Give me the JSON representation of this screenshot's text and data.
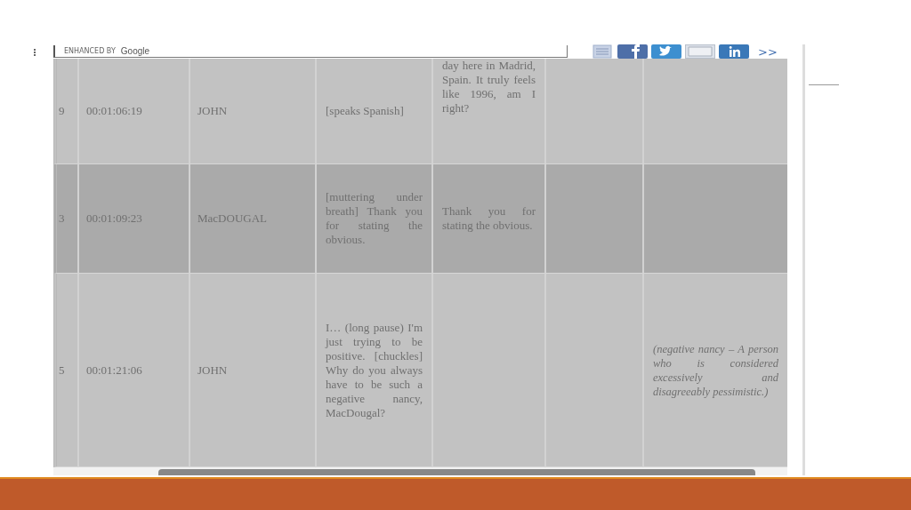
{
  "search": {
    "label": "ENHANCED BY",
    "brand": "Google"
  },
  "share_more": ">>",
  "table": {
    "rows": [
      {
        "number": "9",
        "time": "00:01:06:19",
        "speaker": "JOHN",
        "line": "[speaks Spanish]",
        "translation": "day here in Madrid, Spain. It truly feels like 1996, am I right?",
        "note": ""
      },
      {
        "number": "3",
        "time": "00:01:09:23",
        "speaker": "MacDOUGAL",
        "line": "[muttering under breath] Thank you for stating the obvious.",
        "translation": "Thank you for stating the obvious.",
        "note": ""
      },
      {
        "number": "5",
        "time": "00:01:21:06",
        "speaker": "JOHN",
        "line": "I… (long pause) I'm just trying to be positive. [chuckles] Why do you always have to be such a negative nancy, MacDougal?",
        "translation": "",
        "note": "(negative nancy – A person who is considered excessively and disagreeably pessimistic.)"
      }
    ]
  }
}
